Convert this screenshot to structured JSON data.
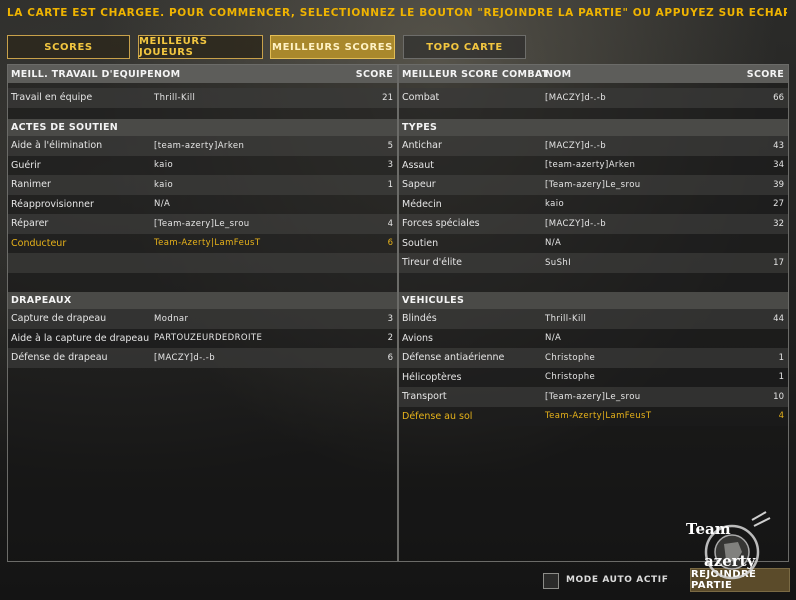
{
  "header": {
    "message": "LA CARTE EST CHARGEE. POUR COMMENCER, SELECTIONNEZ LE BOUTON \"REJOINDRE LA PARTIE\" OU APPUYEZ SUR ECHAP"
  },
  "tabs": [
    {
      "label": "SCORES"
    },
    {
      "label": "MEILLEURS JOUEURS"
    },
    {
      "label": "MEILLEURS SCORES",
      "active": true
    },
    {
      "label": "TOPO CARTE"
    }
  ],
  "left": {
    "header": {
      "title": "MEILL. TRAVAIL D'EQUIPE",
      "name": "NOM",
      "score": "SCORE"
    },
    "teamwork": [
      {
        "label": "Travail en équipe",
        "name": "Thrill-Kill",
        "score": "21"
      }
    ],
    "support_title": "ACTES DE SOUTIEN",
    "support": [
      {
        "label": "Aide à l'élimination",
        "name": "[team-azerty]Arken",
        "score": "5"
      },
      {
        "label": "Guérir",
        "name": "kaio",
        "score": "3"
      },
      {
        "label": "Ranimer",
        "name": "kaio",
        "score": "1"
      },
      {
        "label": "Réapprovisionner",
        "name": "N/A",
        "score": ""
      },
      {
        "label": "Réparer",
        "name": "[Team-azery]Le_srou",
        "score": "4"
      },
      {
        "label": "Conducteur",
        "name": "Team-Azerty|LamFeusT",
        "score": "6"
      }
    ],
    "flags_title": "DRAPEAUX",
    "flags": [
      {
        "label": "Capture de drapeau",
        "name": "Modnar",
        "score": "3"
      },
      {
        "label": "Aide à la capture de drapeau",
        "name": "PARTOUZEURDEDROITE",
        "score": "2"
      },
      {
        "label": "Défense de drapeau",
        "name": "[MACZY]d-.-b",
        "score": "6"
      }
    ]
  },
  "right": {
    "header": {
      "title": "MEILLEUR SCORE COMBAT",
      "name": "NOM",
      "score": "SCORE"
    },
    "combat": [
      {
        "label": "Combat",
        "name": "[MACZY]d-.-b",
        "score": "66"
      }
    ],
    "types_title": "TYPES",
    "types": [
      {
        "label": "Antichar",
        "name": "[MACZY]d-.-b",
        "score": "43"
      },
      {
        "label": "Assaut",
        "name": "[team-azerty]Arken",
        "score": "34"
      },
      {
        "label": "Sapeur",
        "name": "[Team-azery]Le_srou",
        "score": "39"
      },
      {
        "label": "Médecin",
        "name": "kaio",
        "score": "27"
      },
      {
        "label": "Forces spéciales",
        "name": "[MACZY]d-.-b",
        "score": "32"
      },
      {
        "label": "Soutien",
        "name": "N/A",
        "score": ""
      },
      {
        "label": "Tireur d'élite",
        "name": "SuShI",
        "score": "17"
      }
    ],
    "vehicles_title": "VEHICULES",
    "vehicles": [
      {
        "label": "Blindés",
        "name": "Thrill-Kill",
        "score": "44"
      },
      {
        "label": "Avions",
        "name": "N/A",
        "score": ""
      },
      {
        "label": "Défense antiaérienne",
        "name": "Christophe",
        "score": "1"
      },
      {
        "label": "Hélicoptères",
        "name": "Christophe",
        "score": "1"
      },
      {
        "label": "Transport",
        "name": "[Team-azery]Le_srou",
        "score": "10"
      },
      {
        "label": "Défense au sol",
        "name": "Team-Azerty|LamFeusT",
        "score": "4"
      }
    ]
  },
  "footer": {
    "auto_mode_label": "MODE AUTO ACTIF",
    "join_label": "REJOINDRE PARTIE",
    "logo_line1": "Team",
    "logo_line2": "azerty"
  }
}
